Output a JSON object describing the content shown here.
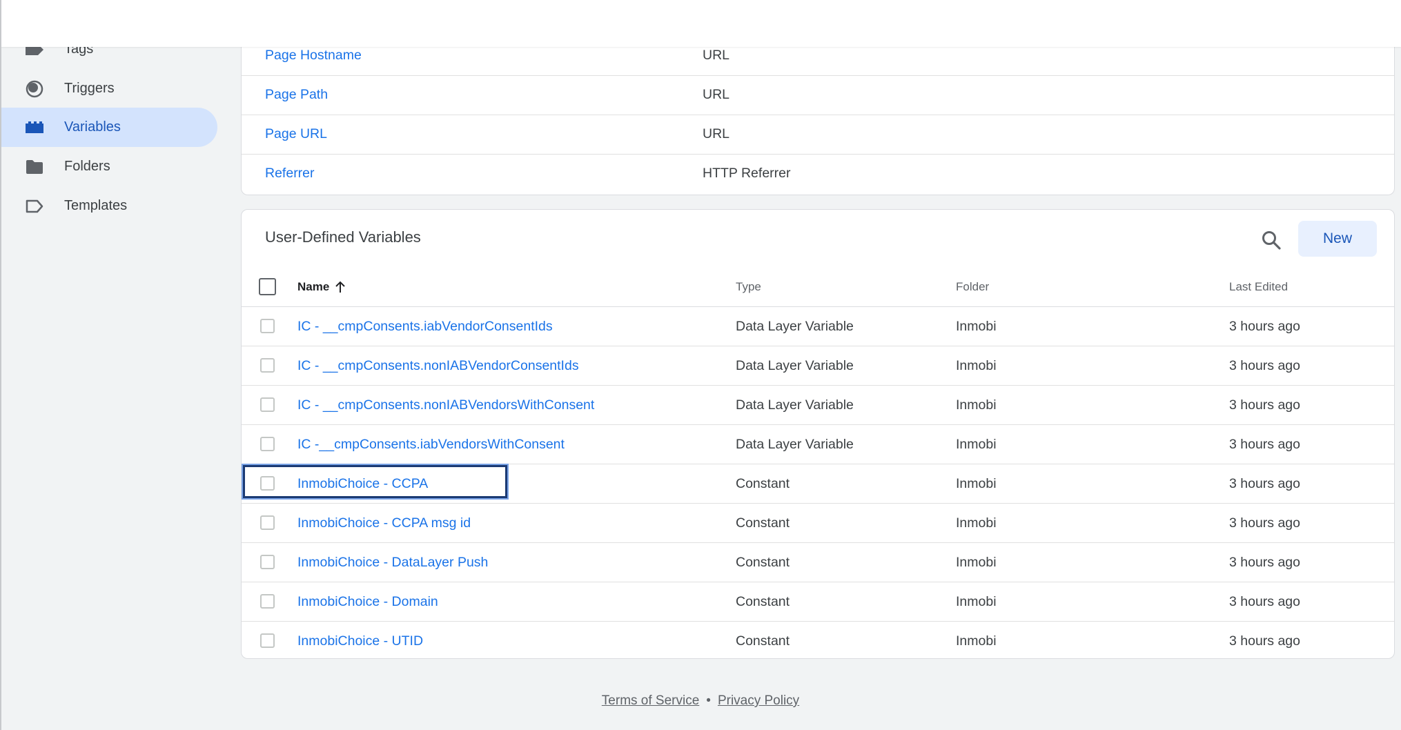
{
  "sidebar": {
    "items": [
      {
        "label": "Tags",
        "icon": "tag-icon"
      },
      {
        "label": "Triggers",
        "icon": "trigger-icon"
      },
      {
        "label": "Variables",
        "icon": "variables-icon",
        "active": true
      },
      {
        "label": "Folders",
        "icon": "folder-icon"
      },
      {
        "label": "Templates",
        "icon": "template-icon"
      }
    ]
  },
  "builtin_variables": {
    "rows": [
      {
        "name": "Page Hostname",
        "type": "URL"
      },
      {
        "name": "Page Path",
        "type": "URL"
      },
      {
        "name": "Page URL",
        "type": "URL"
      },
      {
        "name": "Referrer",
        "type": "HTTP Referrer"
      }
    ]
  },
  "user_defined": {
    "title": "User-Defined Variables",
    "new_label": "New",
    "columns": {
      "name": "Name",
      "type": "Type",
      "folder": "Folder",
      "last_edited": "Last Edited"
    },
    "sort_icon": "arrow-up-icon",
    "rows": [
      {
        "name": "IC - __cmpConsents.iabVendorConsentIds",
        "type": "Data Layer Variable",
        "folder": "Inmobi",
        "edited": "3 hours ago"
      },
      {
        "name": "IC - __cmpConsents.nonIABVendorConsentIds",
        "type": "Data Layer Variable",
        "folder": "Inmobi",
        "edited": "3 hours ago"
      },
      {
        "name": "IC - __cmpConsents.nonIABVendorsWithConsent",
        "type": "Data Layer Variable",
        "folder": "Inmobi",
        "edited": "3 hours ago"
      },
      {
        "name": "IC -__cmpConsents.iabVendorsWithConsent",
        "type": "Data Layer Variable",
        "folder": "Inmobi",
        "edited": "3 hours ago"
      },
      {
        "name": "InmobiChoice - CCPA",
        "type": "Constant",
        "folder": "Inmobi",
        "edited": "3 hours ago",
        "focused": true
      },
      {
        "name": "InmobiChoice - CCPA msg id",
        "type": "Constant",
        "folder": "Inmobi",
        "edited": "3 hours ago"
      },
      {
        "name": "InmobiChoice - DataLayer Push",
        "type": "Constant",
        "folder": "Inmobi",
        "edited": "3 hours ago"
      },
      {
        "name": "InmobiChoice - Domain",
        "type": "Constant",
        "folder": "Inmobi",
        "edited": "3 hours ago"
      },
      {
        "name": "InmobiChoice - UTID",
        "type": "Constant",
        "folder": "Inmobi",
        "edited": "3 hours ago"
      }
    ]
  },
  "footer": {
    "terms": "Terms of Service",
    "separator": "•",
    "privacy": "Privacy Policy"
  },
  "colors": {
    "accent": "#1a73e8",
    "active_nav_bg": "#d3e3fd",
    "focus_border": "#1b3a73"
  }
}
